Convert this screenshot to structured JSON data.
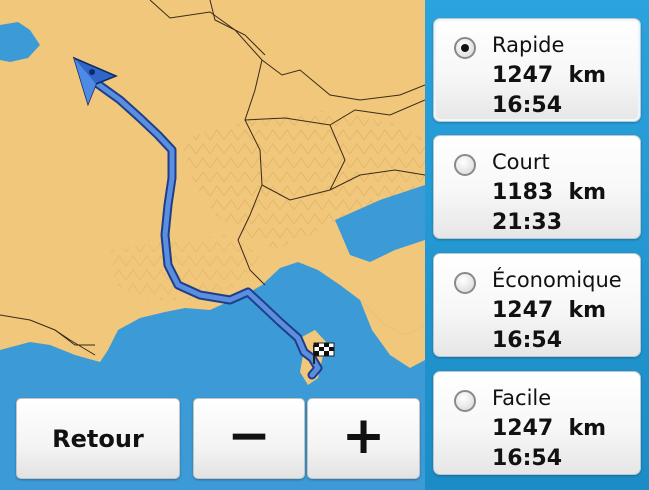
{
  "map": {
    "start_marker": "navigation-arrow",
    "destination_marker": "checkered-flag",
    "route_color": "#4a78c7"
  },
  "routes": [
    {
      "name": "Rapide",
      "distance": "1247  km",
      "time": "16:54",
      "selected": true
    },
    {
      "name": "Court",
      "distance": "1183  km",
      "time": "21:33",
      "selected": false
    },
    {
      "name": "Économique",
      "distance": "1247  km",
      "time": "16:54",
      "selected": false
    },
    {
      "name": "Facile",
      "distance": "1247  km",
      "time": "16:54",
      "selected": false
    }
  ],
  "controls": {
    "back_label": "Retour",
    "zoom_out_label": "−",
    "zoom_in_label": "+"
  },
  "colors": {
    "panel": "#2ba3dd",
    "land": "#f0c77b",
    "sea": "#3c9bd6",
    "route": "#4a78c7"
  }
}
